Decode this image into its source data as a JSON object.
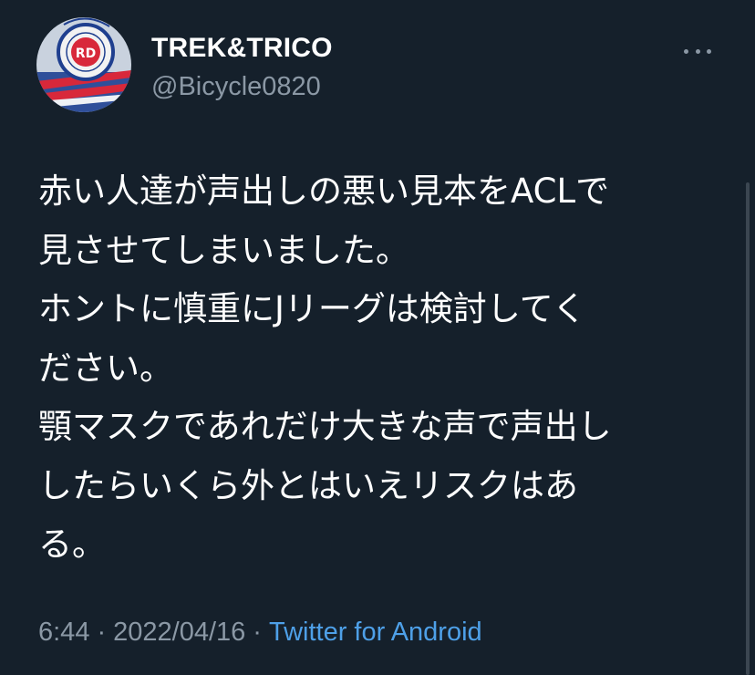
{
  "author": {
    "display_name": "TREK&TRICO",
    "handle": "@Bicycle0820",
    "avatar_icon": "team-emblem-avatar"
  },
  "more_icon": "more-horizontal-icon",
  "tweet": {
    "lines": [
      "赤い人達が声出しの悪い見本をACLで",
      "見させてしまいました。",
      "ホントに慎重にJリーグは検討してく",
      "ださい。",
      "顎マスクであれだけ大きな声で声出し",
      "したらいくら外とはいえリスクはあ",
      "る。"
    ]
  },
  "meta": {
    "time": "6:44",
    "separator": "·",
    "date": "2022/04/16",
    "source": "Twitter for Android"
  },
  "colors": {
    "background": "#15202b",
    "text": "#ffffff",
    "secondary": "#8b98a5",
    "link": "#4ea0e8"
  }
}
